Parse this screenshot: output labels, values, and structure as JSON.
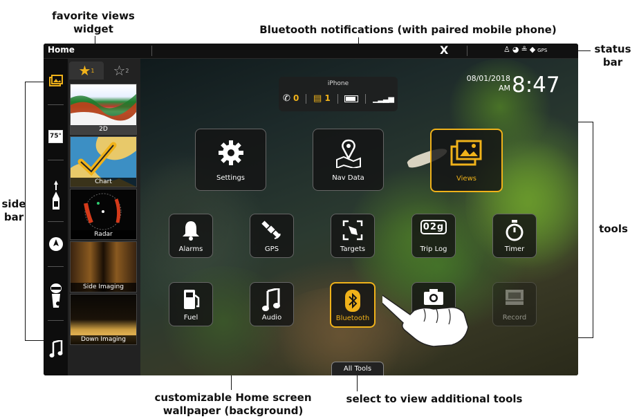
{
  "annotations": {
    "favorite_views_widget": "favorite views widget",
    "bluetooth_notifications": "Bluetooth notifications (with paired mobile phone)",
    "status_bar": "status bar",
    "side_bar": "side bar",
    "tools": "tools",
    "wallpaper": "customizable Home screen wallpaper (background)",
    "all_tools_hint": "select to view additional tools"
  },
  "status_bar": {
    "title": "Home",
    "logo": "X",
    "gps_label": "GPS"
  },
  "side_bar": {
    "items": [
      {
        "icon": "views-icon"
      },
      {
        "icon": "temperature-icon",
        "text": "75°"
      },
      {
        "icon": "boat-heading-icon"
      },
      {
        "icon": "chart-compass-icon"
      },
      {
        "icon": "diver-icon"
      },
      {
        "icon": "music-note-icon"
      }
    ]
  },
  "favorites": {
    "tabs": [
      {
        "icon": "star-filled-icon",
        "sub": "1"
      },
      {
        "icon": "star-outline-icon",
        "sub": "2"
      }
    ],
    "items": [
      {
        "label": "2D"
      },
      {
        "label": "Chart"
      },
      {
        "label": "Radar"
      },
      {
        "label": "Side Imaging"
      },
      {
        "label": "Down Imaging"
      }
    ]
  },
  "bluetooth": {
    "device": "iPhone",
    "missed_calls": "0",
    "messages": "1"
  },
  "clock": {
    "date": "08/01/2018",
    "ampm": "AM",
    "time": "8:47"
  },
  "tools": [
    {
      "label": "Settings",
      "icon": "gear-icon"
    },
    {
      "label": "Nav Data",
      "icon": "map-pin-icon"
    },
    {
      "label": "Views",
      "icon": "views-icon",
      "selected": true
    },
    {
      "label": "Alarms",
      "icon": "bell-icon"
    },
    {
      "label": "GPS",
      "icon": "satellite-icon"
    },
    {
      "label": "Targets",
      "icon": "targets-icon"
    },
    {
      "label": "Trip Log",
      "icon": "odometer-icon",
      "odometer": "02g"
    },
    {
      "label": "Timer",
      "icon": "stopwatch-icon"
    },
    {
      "label": "Fuel",
      "icon": "fuel-pump-icon"
    },
    {
      "label": "Audio",
      "icon": "music-note-icon"
    },
    {
      "label": "Bluetooth",
      "icon": "bluetooth-icon",
      "selected": true
    },
    {
      "label": "",
      "icon": "camera-icon"
    },
    {
      "label": "Record",
      "icon": "record-icon"
    }
  ],
  "all_tools": {
    "label": "All Tools"
  },
  "colors": {
    "accent": "#f0b21a",
    "tile_bg": "#141414",
    "frame": "#0b0b0b"
  }
}
